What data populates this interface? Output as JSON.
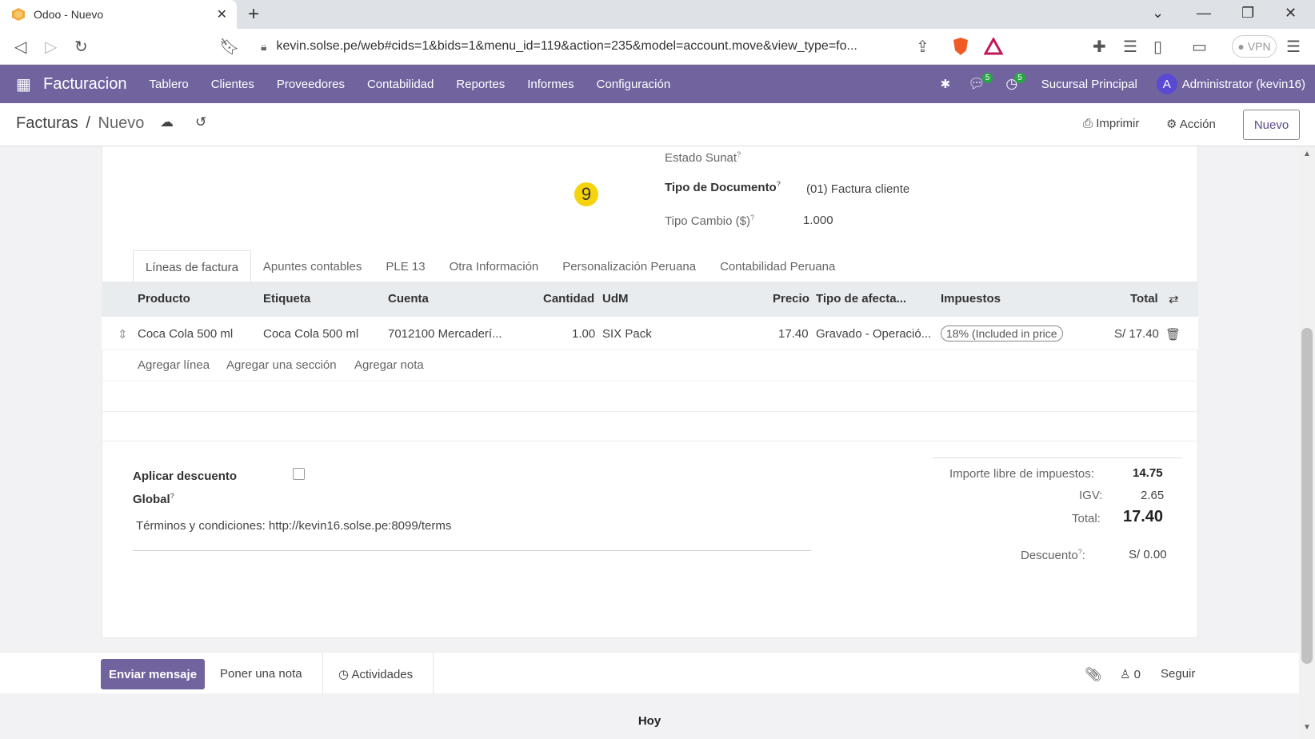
{
  "browser": {
    "tab_title": "Odoo - Nuevo",
    "url": "kevin.solse.pe/web#cids=1&bids=1&menu_id=119&action=235&model=account.move&view_type=fo...",
    "vpn_label": "VPN"
  },
  "navbar": {
    "brand": "Facturacion",
    "menu": [
      "Tablero",
      "Clientes",
      "Proveedores",
      "Contabilidad",
      "Reportes",
      "Informes",
      "Configuración"
    ],
    "messages_count": "5",
    "activities_count": "5",
    "company": "Sucursal Principal",
    "avatar_letter": "A",
    "user": "Administrator (kevin16)"
  },
  "control_panel": {
    "breadcrumb_parent": "Facturas",
    "breadcrumb_sep": "/",
    "breadcrumb_current": "Nuevo",
    "print_label": "Imprimir",
    "action_label": "Acción",
    "new_label": "Nuevo"
  },
  "form": {
    "estado_sunat_label": "Estado Sunat",
    "tipo_documento_label": "Tipo de Documento",
    "tipo_documento_value": "(01) Factura cliente",
    "tipo_cambio_label": "Tipo Cambio ($)",
    "tipo_cambio_value": "1.000",
    "help_mark": "?",
    "step_marker": "9"
  },
  "tabs": [
    "Líneas de factura",
    "Apuntes contables",
    "PLE 13",
    "Otra Información",
    "Personalización Peruana",
    "Contabilidad Peruana"
  ],
  "table": {
    "headers": {
      "producto": "Producto",
      "etiqueta": "Etiqueta",
      "cuenta": "Cuenta",
      "cantidad": "Cantidad",
      "udm": "UdM",
      "precio": "Precio",
      "tipo": "Tipo de afecta...",
      "impuestos": "Impuestos",
      "total": "Total"
    },
    "row": {
      "producto": "Coca Cola 500 ml",
      "etiqueta": "Coca Cola 500 ml",
      "cuenta": "7012100 Mercaderí...",
      "cantidad": "1.00",
      "udm": "SIX Pack",
      "precio": "17.40",
      "tipo": "Gravado - Operació...",
      "impuestos": "18% (Included in price",
      "total": "S/ 17.40"
    },
    "add_line": "Agregar línea",
    "add_section": "Agregar una sección",
    "add_note": "Agregar nota"
  },
  "footer": {
    "discount_label_1": "Aplicar descuento",
    "discount_label_2": "Global",
    "terms": "Términos y condiciones: http://kevin16.solse.pe:8099/terms",
    "untaxed_label": "Importe libre de impuestos:",
    "untaxed_value": "14.75",
    "igv_label": "IGV:",
    "igv_value": "2.65",
    "total_label": "Total:",
    "total_value": "17.40",
    "descuento_label": "Descuento",
    "descuento_colon": ":",
    "descuento_value": "S/ 0.00"
  },
  "chatter": {
    "send_message": "Enviar mensaje",
    "log_note": "Poner una nota",
    "activities": "Actividades",
    "followers_count": "0",
    "follow": "Seguir",
    "day_separator": "Hoy"
  },
  "colors": {
    "navbar": "#71639e",
    "badge": "#28a745",
    "step_marker": "#f5d30d"
  }
}
